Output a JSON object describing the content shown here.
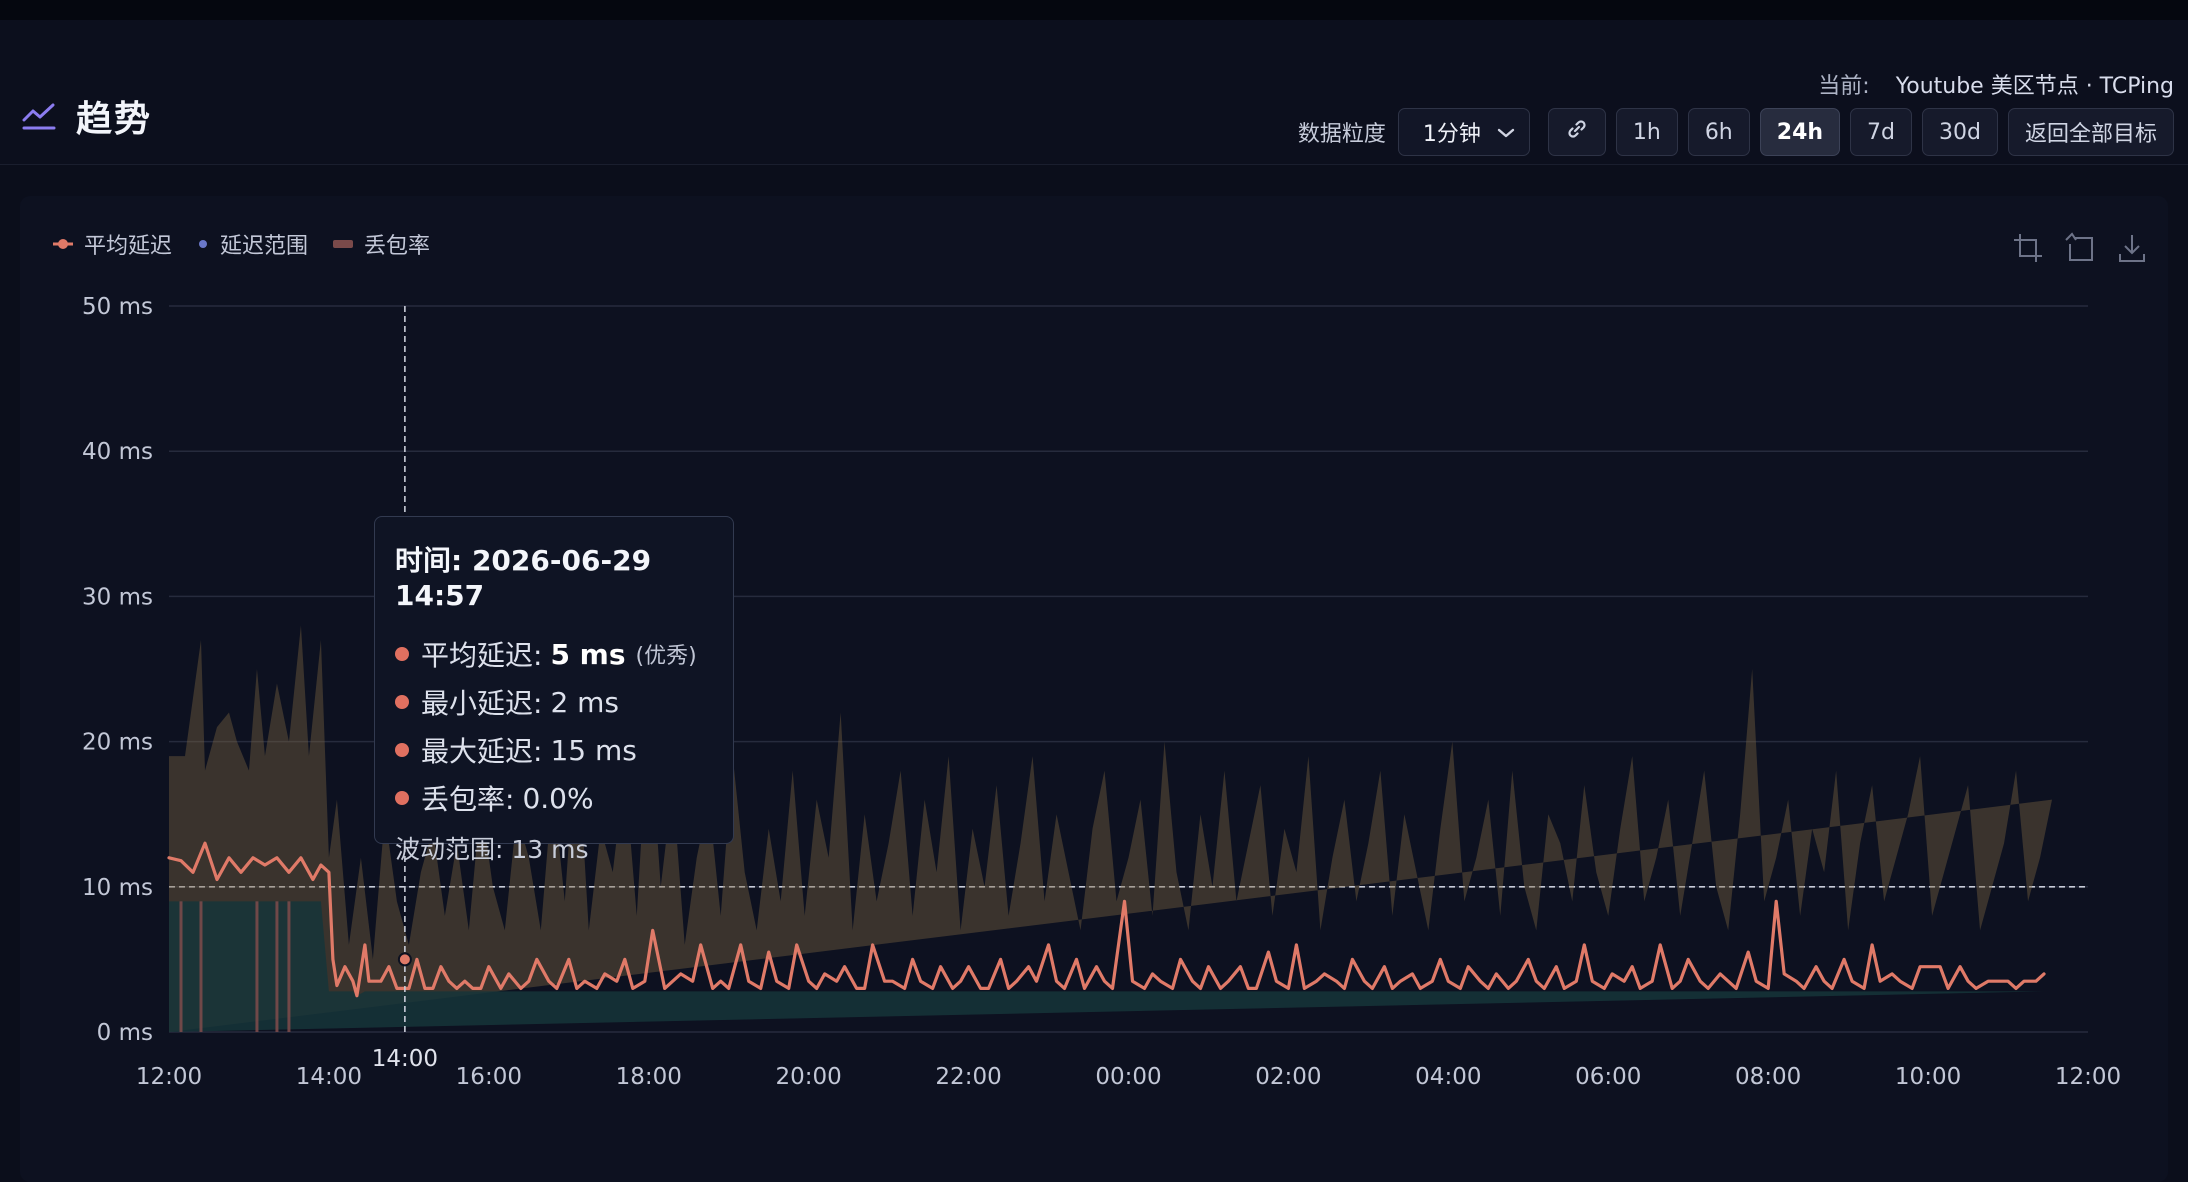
{
  "header": {
    "title": "趋势",
    "current_label": "当前:",
    "current_value": "Youtube 美区节点 · TCPing",
    "granularity_label": "数据粒度",
    "granularity_value": "1分钟",
    "range_buttons": [
      "1h",
      "6h",
      "24h",
      "7d",
      "30d"
    ],
    "active_range": "24h",
    "back_button": "返回全部目标"
  },
  "chart_data": {
    "type": "line",
    "legend": [
      "平均延迟",
      "延迟范围",
      "丢包率"
    ],
    "y_ticks": [
      "0 ms",
      "10 ms",
      "20 ms",
      "30 ms",
      "40 ms",
      "50 ms"
    ],
    "ylim": [
      0,
      50
    ],
    "y_unit": "ms",
    "x_ticks": [
      "12:00",
      "14:00",
      "16:00",
      "18:00",
      "20:00",
      "22:00",
      "00:00",
      "02:00",
      "04:00",
      "06:00",
      "08:00",
      "10:00",
      "12:00"
    ],
    "xlim": [
      "2026-06-29 12:00",
      "2026-06-30 12:00"
    ],
    "reference_line": 10,
    "hover": {
      "time": "2026-06-29 14:57",
      "axis_label": "14:00"
    },
    "series": [
      {
        "name": "平均延迟",
        "color": "#e07a68",
        "x_hours": [
          0,
          0.15,
          0.3,
          0.45,
          0.6,
          0.75,
          0.9,
          1.05,
          1.2,
          1.35,
          1.5,
          1.65,
          1.8,
          1.9,
          2.0,
          2.05,
          2.1,
          2.2,
          2.3,
          2.35,
          2.45,
          2.5,
          2.55,
          2.65,
          2.75,
          2.85,
          3.0,
          3.1,
          3.2,
          3.3,
          3.4,
          3.5,
          3.6,
          3.7,
          3.8,
          3.9,
          4.0,
          4.15,
          4.25,
          4.4,
          4.5,
          4.6,
          4.75,
          4.85,
          5.0,
          5.1,
          5.2,
          5.35,
          5.45,
          5.6,
          5.7,
          5.8,
          5.95,
          6.05,
          6.2,
          6.3,
          6.4,
          6.55,
          6.65,
          6.8,
          6.9,
          7.0,
          7.15,
          7.25,
          7.4,
          7.5,
          7.6,
          7.75,
          7.85,
          8.0,
          8.1,
          8.2,
          8.35,
          8.45,
          8.6,
          8.7,
          8.8,
          8.95,
          9.05,
          9.2,
          9.3,
          9.4,
          9.55,
          9.65,
          9.8,
          9.9,
          10.0,
          10.15,
          10.25,
          10.4,
          10.5,
          10.6,
          10.75,
          10.85,
          11.0,
          11.1,
          11.2,
          11.35,
          11.45,
          11.6,
          11.7,
          11.8,
          11.95,
          12.05,
          12.2,
          12.3,
          12.4,
          12.55,
          12.65,
          12.8,
          12.9,
          13.0,
          13.15,
          13.25,
          13.4,
          13.5,
          13.6,
          13.75,
          13.85,
          14.0,
          14.1,
          14.2,
          14.35,
          14.45,
          14.6,
          14.7,
          14.8,
          14.95,
          15.05,
          15.2,
          15.3,
          15.4,
          15.55,
          15.65,
          15.8,
          15.9,
          16.0,
          16.15,
          16.25,
          16.4,
          16.5,
          16.6,
          16.75,
          16.85,
          17.0,
          17.1,
          17.2,
          17.35,
          17.45,
          17.6,
          17.7,
          17.8,
          17.95,
          18.05,
          18.2,
          18.3,
          18.4,
          18.55,
          18.65,
          18.8,
          18.9,
          19.0,
          19.15,
          19.25,
          19.4,
          19.5,
          19.6,
          19.75,
          19.85,
          20.0,
          20.1,
          20.2,
          20.35,
          20.45,
          20.6,
          20.7,
          20.8,
          20.95,
          21.05,
          21.2,
          21.3,
          21.4,
          21.55,
          21.65,
          21.8,
          21.9,
          22.0,
          22.15,
          22.25,
          22.4,
          22.5,
          22.6,
          22.75,
          22.85,
          23.0,
          23.1,
          23.2,
          23.35,
          23.45,
          23.6,
          23.7,
          23.8,
          23.95,
          24.0
        ],
        "values": [
          12,
          11.8,
          11,
          13,
          10.5,
          12,
          11,
          12,
          11.5,
          12,
          11,
          12,
          10.5,
          11.5,
          11,
          5,
          3.2,
          4.5,
          3.5,
          2.5,
          6,
          3.5,
          3.5,
          3.5,
          4.5,
          3,
          3,
          5,
          3,
          3,
          4.5,
          3.5,
          3,
          3.5,
          3,
          3,
          4.5,
          3,
          4,
          3,
          3.5,
          5,
          3.5,
          3,
          5,
          3,
          3.5,
          3,
          4,
          3.5,
          5,
          3,
          3.5,
          7,
          3,
          3.5,
          4,
          3.5,
          6,
          3,
          3.5,
          3,
          6,
          3.5,
          3,
          5.5,
          3.5,
          3,
          6,
          3.5,
          3,
          4,
          3.5,
          4.5,
          3,
          3,
          6,
          3.5,
          3.5,
          3,
          5,
          3.5,
          3,
          4.5,
          3,
          3.5,
          4.5,
          3,
          3,
          5,
          3,
          3.5,
          4.5,
          3.5,
          6,
          3.5,
          3,
          5,
          3,
          4.5,
          3.5,
          3,
          9,
          3.5,
          3,
          4,
          3.5,
          3,
          5,
          3.5,
          3,
          4.5,
          3,
          3.5,
          4.5,
          3,
          3,
          5.5,
          3.5,
          3,
          6,
          3,
          3.5,
          4,
          3.5,
          3,
          5,
          3.5,
          3,
          4.5,
          3,
          3.5,
          4,
          3,
          3.5,
          5,
          3.5,
          3,
          4.5,
          3.5,
          3,
          4,
          3,
          3.5,
          5,
          3.5,
          3,
          4.5,
          3,
          3.5,
          6,
          3.5,
          3,
          4,
          3.5,
          4.5,
          3,
          3.5,
          6,
          3,
          3.5,
          5,
          3.5,
          3,
          4,
          3.5,
          3,
          5.5,
          3.5,
          3,
          9,
          4,
          3.5,
          3,
          4.5,
          3.5,
          3,
          5,
          3.5,
          3,
          6,
          3.5,
          4,
          3.5,
          3,
          4.5,
          4.5,
          4.5,
          3,
          4.5,
          3.5,
          3,
          3.5,
          3.5,
          3.5,
          3,
          3.5,
          3.5,
          4
        ]
      },
      {
        "name": "延迟范围",
        "color": "#6a78c9",
        "x_hours": [
          0,
          0.2,
          0.4,
          0.45,
          0.6,
          0.75,
          0.85,
          1.0,
          1.1,
          1.2,
          1.35,
          1.5,
          1.65,
          1.75,
          1.9,
          2.0,
          2.1,
          2.25,
          2.4,
          2.55,
          2.7,
          2.85,
          3.0,
          3.15,
          3.3,
          3.45,
          3.6,
          3.75,
          3.9,
          4.05,
          4.2,
          4.35,
          4.5,
          4.65,
          4.8,
          4.95,
          5.1,
          5.25,
          5.4,
          5.55,
          5.7,
          5.85,
          6.0,
          6.15,
          6.3,
          6.45,
          6.6,
          6.75,
          6.9,
          7.05,
          7.2,
          7.35,
          7.5,
          7.65,
          7.8,
          7.95,
          8.1,
          8.25,
          8.4,
          8.55,
          8.7,
          8.85,
          9.0,
          9.15,
          9.3,
          9.45,
          9.6,
          9.75,
          9.9,
          10.05,
          10.2,
          10.35,
          10.5,
          10.65,
          10.8,
          10.95,
          11.1,
          11.25,
          11.4,
          11.55,
          11.7,
          11.85,
          12.0,
          12.15,
          12.3,
          12.45,
          12.6,
          12.75,
          12.9,
          13.05,
          13.2,
          13.35,
          13.5,
          13.65,
          13.8,
          13.95,
          14.1,
          14.25,
          14.4,
          14.55,
          14.7,
          14.85,
          15.0,
          15.15,
          15.3,
          15.45,
          15.6,
          15.75,
          15.9,
          16.05,
          16.2,
          16.35,
          16.5,
          16.65,
          16.8,
          16.95,
          17.1,
          17.25,
          17.4,
          17.55,
          17.7,
          17.85,
          18.0,
          18.15,
          18.3,
          18.45,
          18.6,
          18.75,
          18.9,
          19.05,
          19.2,
          19.35,
          19.5,
          19.65,
          19.8,
          19.95,
          20.1,
          20.25,
          20.4,
          20.55,
          20.7,
          20.85,
          21.0,
          21.15,
          21.3,
          21.45,
          21.6,
          21.75,
          21.9,
          22.05,
          22.2,
          22.35,
          22.5,
          22.65,
          22.8,
          22.95,
          23.1,
          23.25,
          23.4,
          23.55,
          23.7,
          23.85,
          24.0
        ],
        "max": [
          19,
          19,
          27,
          18,
          21,
          22,
          20,
          18,
          25,
          19,
          24,
          20,
          28,
          19,
          27,
          12,
          16,
          6,
          12,
          5,
          15,
          9,
          6,
          11,
          14,
          8,
          13,
          7,
          16,
          10,
          7,
          15,
          12,
          7,
          17,
          9,
          21,
          7,
          14,
          11,
          18,
          8,
          22,
          10,
          17,
          6,
          12,
          16,
          8,
          19,
          11,
          7,
          14,
          9,
          18,
          8,
          16,
          12,
          22,
          7,
          15,
          9,
          13,
          18,
          8,
          16,
          11,
          19,
          7,
          14,
          10,
          17,
          8,
          13,
          19,
          9,
          15,
          11,
          7,
          14,
          18,
          9,
          12,
          16,
          8,
          20,
          11,
          7,
          15,
          10,
          18,
          9,
          13,
          17,
          8,
          14,
          11,
          19,
          7,
          12,
          16,
          9,
          13,
          18,
          8,
          15,
          11,
          7,
          14,
          20,
          9,
          12,
          16,
          8,
          18,
          10,
          7,
          15,
          13,
          9,
          17,
          11,
          8,
          14,
          19,
          9,
          12,
          16,
          8,
          13,
          18,
          10,
          7,
          15,
          25,
          9,
          12,
          16,
          8,
          14,
          11,
          18,
          7,
          13,
          17,
          9,
          12,
          15,
          19,
          8,
          11,
          14,
          17,
          7,
          10,
          13,
          18,
          9,
          12,
          16
        ]
      },
      {
        "name": "丢包率",
        "color": "#7a4a4a",
        "x_hours": [
          0.15,
          0.4,
          1.1,
          1.35,
          1.5
        ],
        "values": [
          1,
          1,
          1,
          1,
          1
        ]
      }
    ]
  },
  "tooltip": {
    "time_label": "时间: 2026-06-29 14:57",
    "avg_label": "平均延迟:",
    "avg_value": "5 ms",
    "avg_note": "(优秀)",
    "min_label": "最小延迟:",
    "min_value": "2 ms",
    "max_label": "最大延迟:",
    "max_value": "15 ms",
    "loss_label": "丢包率:",
    "loss_value": "0.0%",
    "range_label": "波动范围:",
    "range_value": "13 ms"
  },
  "colors": {
    "background": "#0b0e1b",
    "panel": "#0d1120",
    "avg_line": "#e07a68",
    "range_fill": "#7a6440",
    "lower_fill": "#16353a",
    "accent_icon": "#8c7cf0"
  },
  "icons": [
    "trend-icon",
    "chevron-down-icon",
    "link-icon",
    "zoom-icon",
    "zoom-reset-icon",
    "download-icon"
  ]
}
